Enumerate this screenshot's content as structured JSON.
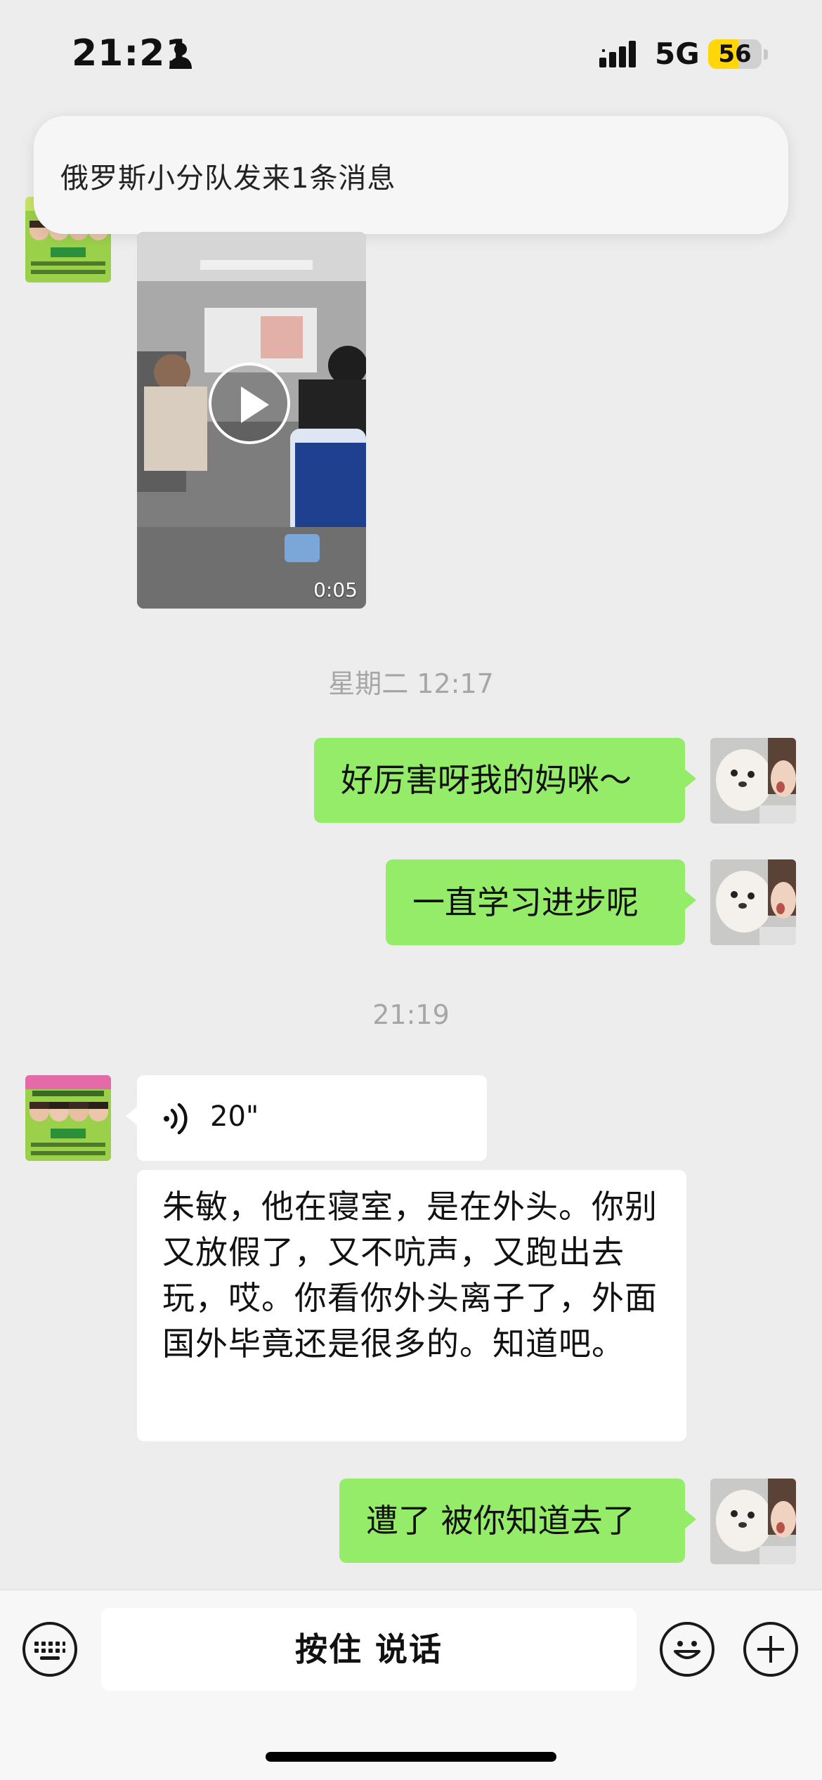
{
  "status_bar": {
    "time": "21:21",
    "network": "5G",
    "battery_percent": "56",
    "battery_level": 0.56,
    "icons": [
      "person-icon",
      "signal-icon"
    ]
  },
  "notification": {
    "text": "俄罗斯小分队发来1条消息"
  },
  "video_message": {
    "duration": "0:05",
    "icon": "play-icon"
  },
  "messages": {
    "timestamp_1": "星期二 12:17",
    "m1": "好厉害呀我的妈咪～",
    "m2": "一直学习进步呢",
    "timestamp_2": "21:19",
    "voice_duration": "20\"",
    "transcript": "朱敏，他在寝室，是在外头。你别又放假了，又不吭声，又跑出去玩，哎。你看你外头离子了，外面国外毕竟还是很多的。知道吧。",
    "m3": "遭了 被你知道去了"
  },
  "input_bar": {
    "hold_to_talk": "按住 说话",
    "icons": [
      "keyboard-icon",
      "emoji-icon",
      "plus-icon"
    ]
  },
  "colors": {
    "background": "#ededed",
    "sent_bubble": "#95ec69",
    "received_bubble": "#ffffff",
    "timestamp": "#a6a6a6",
    "battery": "#ffd60a"
  }
}
